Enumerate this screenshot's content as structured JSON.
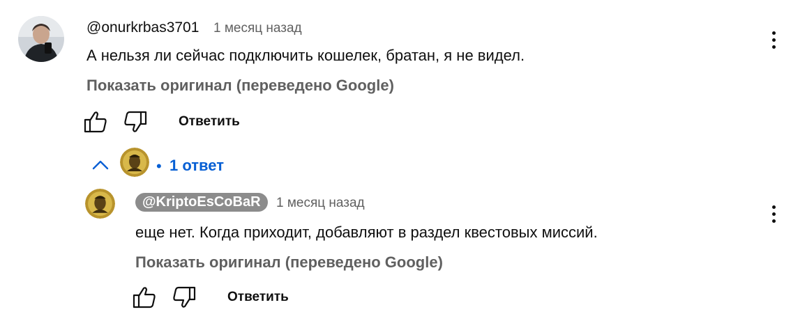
{
  "comment": {
    "author": "@onurkrbas3701",
    "time": "1 месяц назад",
    "text": "А нельзя ли сейчас подключить кошелек, братан, я не видел.",
    "translate_toggle": "Показать оригинал (переведено Google)",
    "reply_label": "Ответить",
    "replies_toggle": "1 ответ"
  },
  "reply": {
    "author": "@KriptoEsCoBaR",
    "time": "1 месяц назад",
    "text": "еще нет. Когда приходит, добавляют в раздел квестовых миссий.",
    "translate_toggle": "Показать оригинал (переведено Google)",
    "reply_label": "Ответить"
  },
  "colors": {
    "link_blue": "#065fd4",
    "secondary_text": "#606060",
    "chip_bg": "#8c8c8c"
  },
  "icons": [
    "thumbs-up-icon",
    "thumbs-down-icon",
    "more-vert-icon",
    "chevron-up-icon"
  ]
}
